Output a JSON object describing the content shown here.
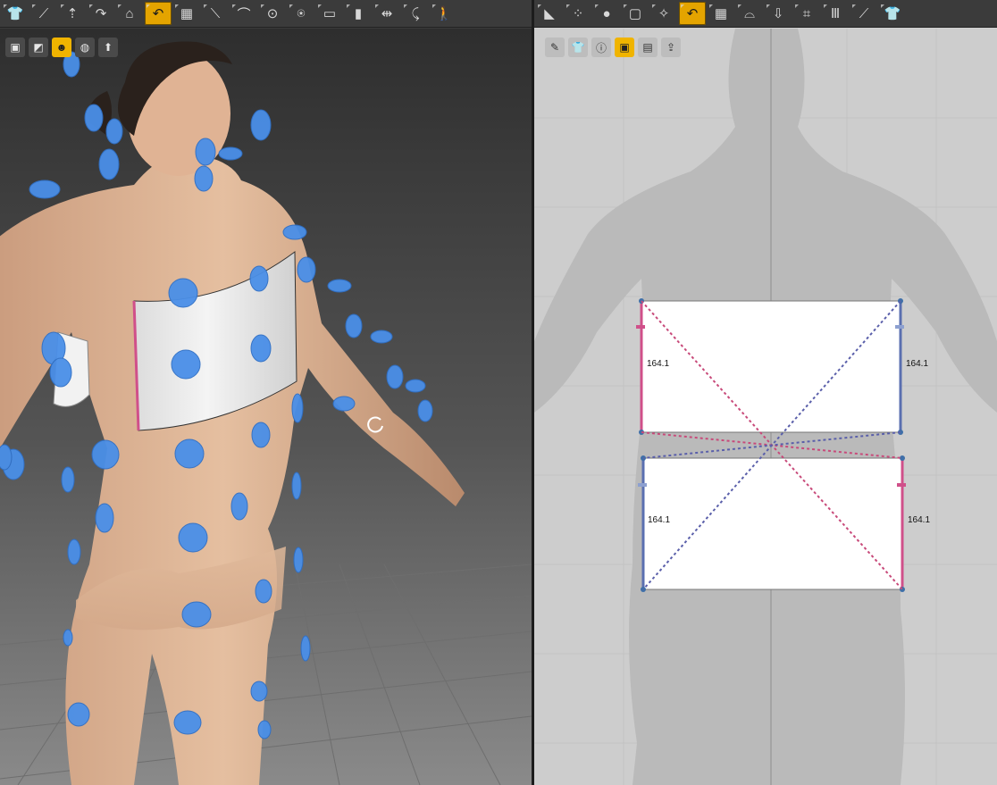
{
  "left_toolbar": {
    "icons": [
      "shirt-icon",
      "wand-icon",
      "garment-icon",
      "rotate-icon",
      "avatar-icon",
      "fold-icon",
      "grid-icon",
      "fold-line-icon",
      "tack-icon",
      "pin-icon",
      "avatar-size-icon",
      "tape-icon",
      "fabric-icon",
      "split-icon",
      "curve-icon",
      "walk-icon"
    ],
    "glyphs": [
      "👕",
      "⟋",
      "⇡",
      "↷",
      "⌂",
      "↶",
      "▦",
      "⟍",
      "⌒",
      "⊙",
      "⍟",
      "▭",
      "▮",
      "⇹",
      "⤹",
      "🚶"
    ],
    "active_index": 5
  },
  "right_toolbar": {
    "icons": [
      "polygon-icon",
      "points-icon",
      "circle-icon",
      "rectangle-icon",
      "dart-icon",
      "fold-icon",
      "grid-icon",
      "pleat-icon",
      "zip-icon",
      "sew-icon",
      "multi-sew-icon",
      "line-icon",
      "tshirt-icon"
    ],
    "glyphs": [
      "◣",
      "⁘",
      "●",
      "▢",
      "✧",
      "↶",
      "▦",
      "⌓",
      "⇩",
      "⌗",
      "Ⅲ",
      "⟋",
      "👕"
    ],
    "active_index": 5
  },
  "left_subtoolbar": {
    "icons": [
      "cube-icon",
      "plane-icon",
      "avatar-skin-icon",
      "globe-icon",
      "arrangement-icon"
    ],
    "glyphs": [
      "▣",
      "◩",
      "☻",
      "◍",
      "⬆"
    ],
    "active_index": 2
  },
  "right_subtoolbar": {
    "icons": [
      "pen-icon",
      "tshirt-icon",
      "info-icon",
      "cube-icon",
      "texture-icon",
      "export-icon"
    ],
    "glyphs": [
      "✎",
      "👕",
      "ⓘ",
      "▣",
      "▤",
      "⇪"
    ],
    "active_index": 3
  },
  "patterns": [
    {
      "left_label": "164.1",
      "right_label": "164.1"
    },
    {
      "left_label": "164.1",
      "right_label": "164.1"
    }
  ],
  "colors": {
    "arrangement_point": "#4a8fe8",
    "seam_pink": "#d0508a",
    "seam_blue": "#5a6fb0",
    "active_tool": "#e4a400"
  }
}
